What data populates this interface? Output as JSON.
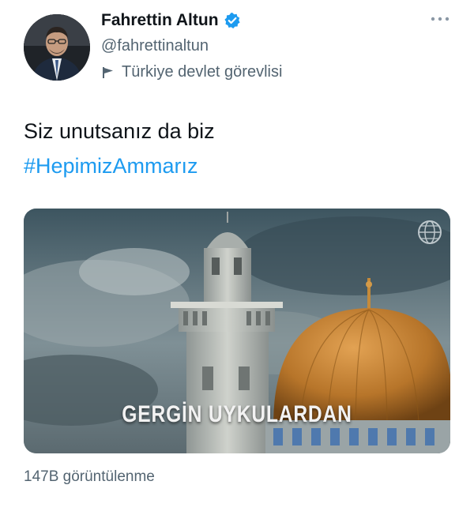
{
  "author": {
    "name": "Fahrettin Altun",
    "handle": "@fahrettinaltun",
    "label": "Türkiye devlet görevlisi",
    "verified_icon": "verified-badge-icon",
    "label_icon": "flag-icon"
  },
  "tweet": {
    "text_line": "Siz unutsanız da biz",
    "hashtag": "#HepimizAmmarız"
  },
  "media": {
    "caption": "GERGİN UYKULARDAN",
    "watermark_icon": "globe-watermark-icon"
  },
  "footer": {
    "views": "147B görüntülenme"
  },
  "colors": {
    "accent": "#1d9bf0",
    "secondary_text": "#536471",
    "primary_text": "#0f1419"
  }
}
